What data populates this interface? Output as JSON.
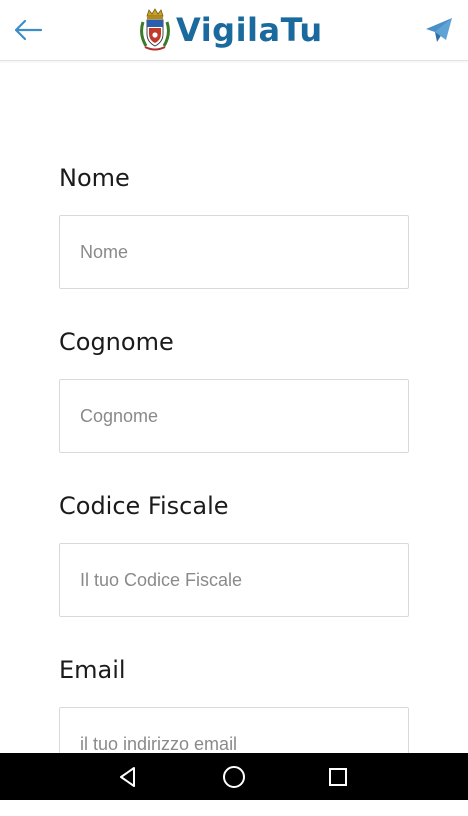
{
  "appbar": {
    "brand": "VigilaTu",
    "icons": {
      "back": "arrow-left-icon",
      "send": "paper-plane-icon",
      "logo": "city-crest-icon"
    },
    "colors": {
      "brand": "#1a6a9e",
      "accent": "#3d8ec6"
    }
  },
  "form": {
    "fields": [
      {
        "label": "Nome",
        "placeholder": "Nome"
      },
      {
        "label": "Cognome",
        "placeholder": "Cognome"
      },
      {
        "label": "Codice Fiscale",
        "placeholder": "Il tuo Codice Fiscale"
      },
      {
        "label": "Email",
        "placeholder": "il tuo indirizzo email"
      }
    ]
  },
  "navbar": {
    "icons": [
      "back-triangle-icon",
      "home-circle-icon",
      "recents-square-icon"
    ]
  }
}
